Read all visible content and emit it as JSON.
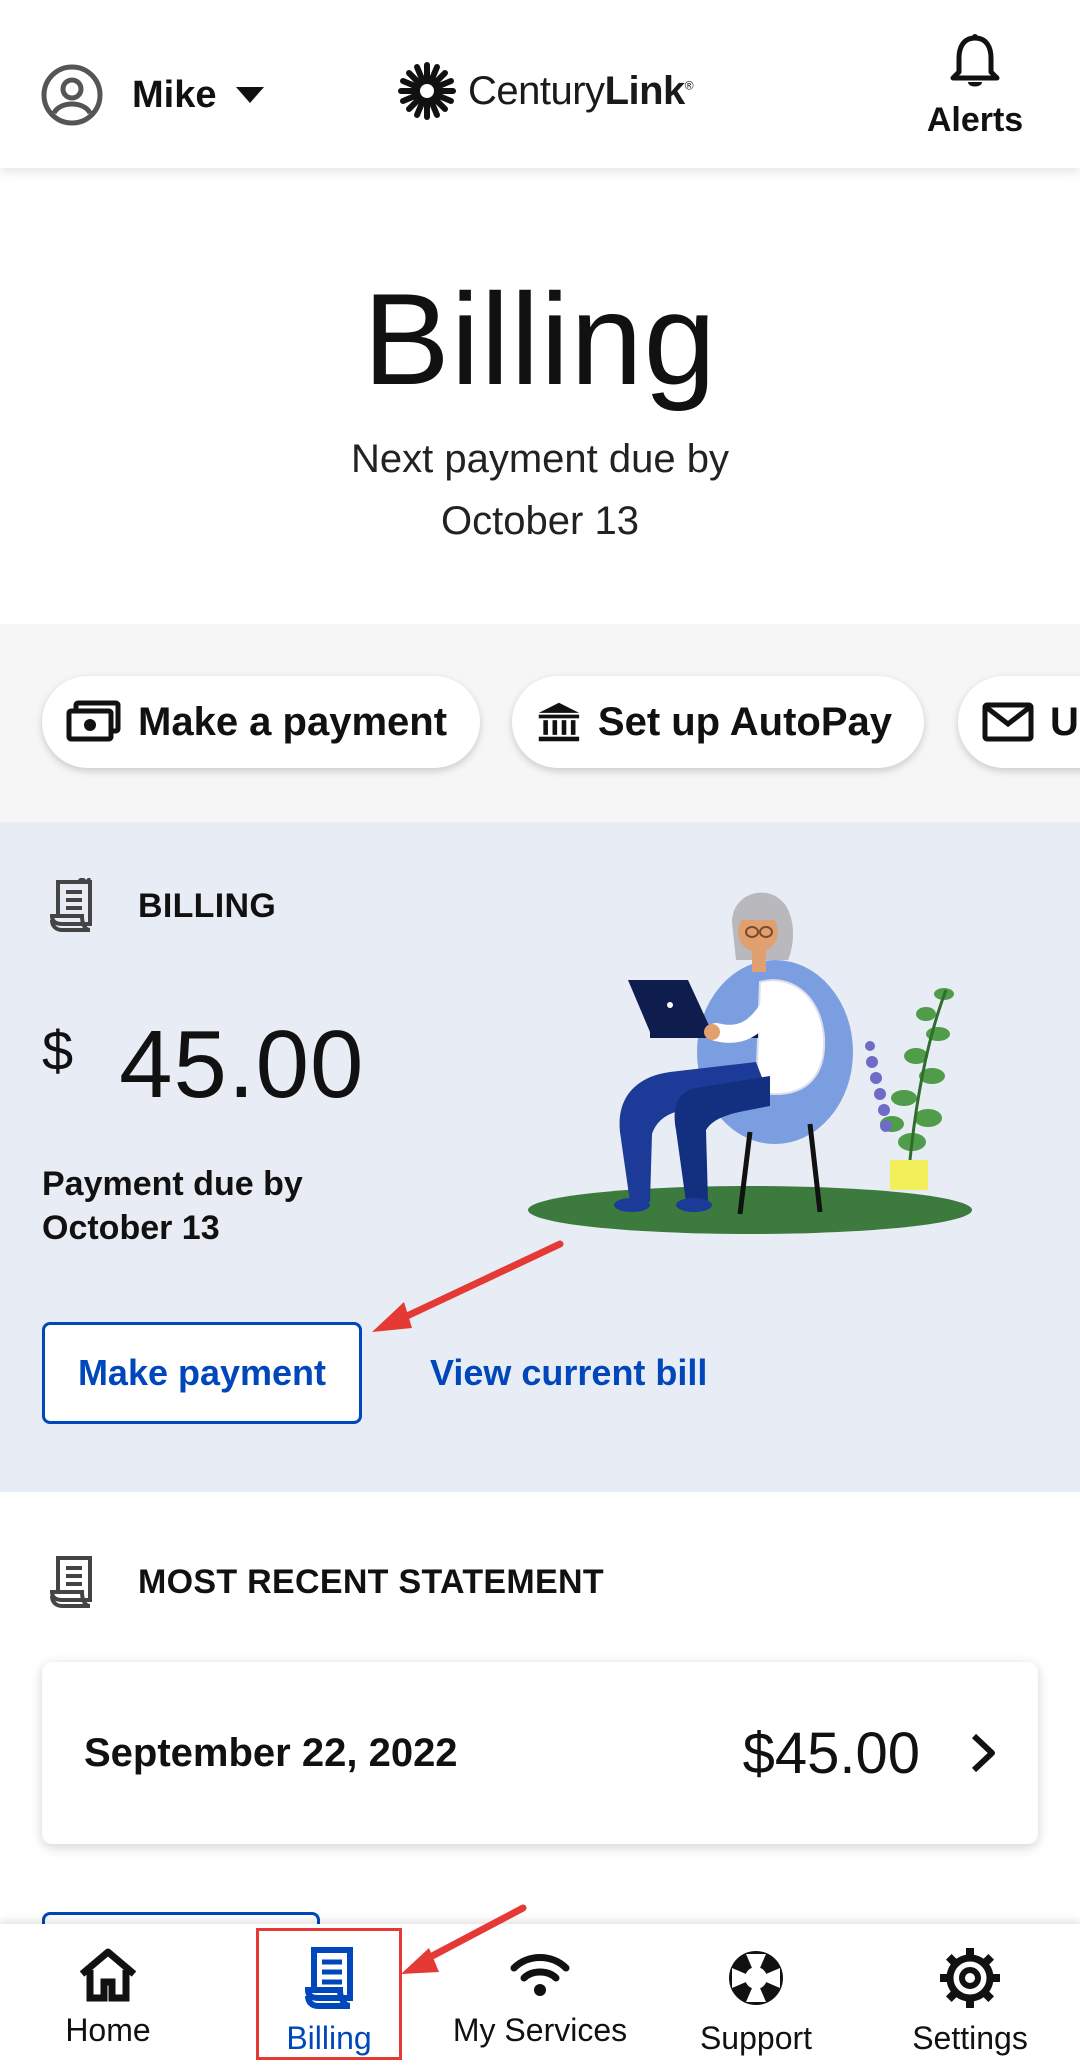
{
  "header": {
    "user_name": "Mike",
    "logo_text_regular": "Century",
    "logo_text_bold": "Link",
    "logo_mark": "®",
    "alerts_label": "Alerts"
  },
  "hero": {
    "title": "Billing",
    "subtitle_line1": "Next payment due by",
    "subtitle_line2": "October 13"
  },
  "quick_actions": [
    {
      "label": "Make a payment",
      "icon": "payment-icon"
    },
    {
      "label": "Set up AutoPay",
      "icon": "bank-icon"
    },
    {
      "label": "U",
      "icon": "mail-icon"
    }
  ],
  "billing": {
    "section_label": "BILLING",
    "currency": "$",
    "amount": "45.00",
    "due_line1": "Payment due by",
    "due_line2": "October 13",
    "make_payment_label": "Make payment",
    "view_bill_label": "View current bill"
  },
  "statement": {
    "section_label": "MOST RECENT STATEMENT",
    "date": "September 22, 2022",
    "amount": "$45.00"
  },
  "bottom_nav": [
    {
      "label": "Home",
      "icon": "home-icon",
      "active": false
    },
    {
      "label": "Billing",
      "icon": "billing-icon",
      "active": true
    },
    {
      "label": "My Services",
      "icon": "wifi-icon",
      "active": false
    },
    {
      "label": "Support",
      "icon": "lifebuoy-icon",
      "active": false
    },
    {
      "label": "Settings",
      "icon": "gear-icon",
      "active": false
    }
  ],
  "colors": {
    "brand_blue": "#0047bb",
    "billing_bg": "#e8ecf4",
    "annotation_red": "#e53935"
  }
}
